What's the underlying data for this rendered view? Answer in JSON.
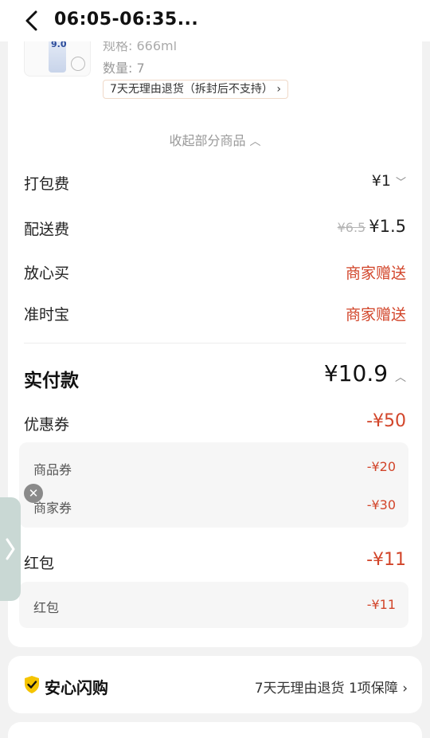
{
  "header": {
    "title": "06:05-06:35..."
  },
  "product": {
    "image_label": "9.0",
    "spec": "规格: 666ml",
    "quantity": "数量: 7",
    "return_policy": "7天无理由退货（拆封后不支持）"
  },
  "collapse_label": "收起部分商品",
  "fees": {
    "packing": {
      "label": "打包费",
      "value": "¥1"
    },
    "delivery": {
      "label": "配送费",
      "original": "¥6.5",
      "value": "¥1.5"
    },
    "assured": {
      "label": "放心买",
      "value": "商家赠送"
    },
    "ontime": {
      "label": "准时宝",
      "value": "商家赠送"
    }
  },
  "total": {
    "label": "实付款",
    "value": "¥10.9"
  },
  "coupons": {
    "label": "优惠券",
    "value": "-¥50",
    "items": [
      {
        "label": "商品券",
        "value": "-¥20"
      },
      {
        "label": "商家券",
        "value": "-¥30"
      }
    ]
  },
  "redpacket": {
    "label": "红包",
    "value": "-¥11",
    "items": [
      {
        "label": "红包",
        "value": "-¥11"
      }
    ]
  },
  "assurance": {
    "title": "安心闪购",
    "summary": "7天无理由退货 1项保障"
  },
  "colors": {
    "accent_red": "#d2452a",
    "shield_yellow": "#f5c400",
    "handle_teal": "#c9d8d4"
  }
}
